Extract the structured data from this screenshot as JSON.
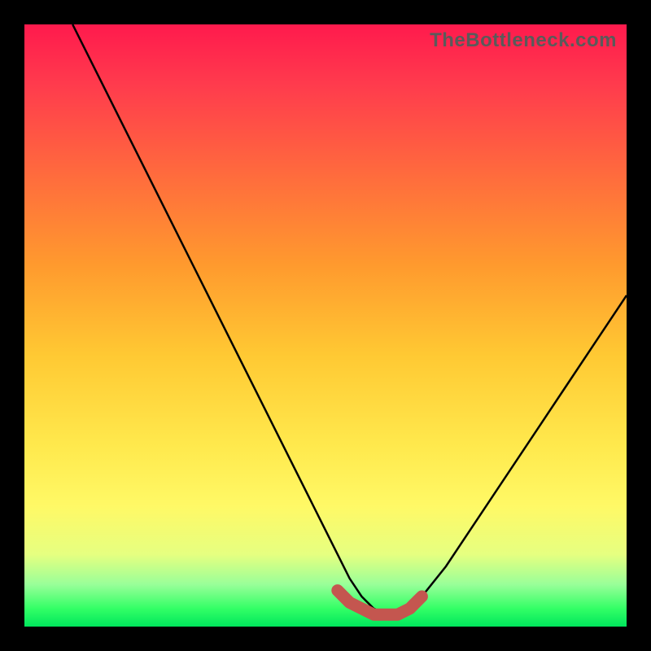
{
  "watermark": "TheBottleneck.com",
  "chart_data": {
    "type": "line",
    "title": "",
    "xlabel": "",
    "ylabel": "",
    "xlim": [
      0,
      100
    ],
    "ylim": [
      0,
      100
    ],
    "series": [
      {
        "name": "bottleneck-curve",
        "x": [
          8,
          12,
          16,
          20,
          24,
          28,
          32,
          36,
          40,
          44,
          48,
          52,
          54,
          56,
          58,
          60,
          62,
          64,
          66,
          70,
          74,
          78,
          82,
          86,
          90,
          94,
          98,
          100
        ],
        "y": [
          100,
          92,
          84,
          76,
          68,
          60,
          52,
          44,
          36,
          28,
          20,
          12,
          8,
          5,
          3,
          2,
          2,
          3,
          5,
          10,
          16,
          22,
          28,
          34,
          40,
          46,
          52,
          55
        ]
      },
      {
        "name": "optimal-region",
        "x": [
          52,
          54,
          56,
          58,
          60,
          62,
          64,
          66
        ],
        "y": [
          6,
          4,
          3,
          2,
          2,
          2,
          3,
          5
        ]
      }
    ],
    "annotations": []
  },
  "colors": {
    "curve": "#000000",
    "optimal": "#c4564f",
    "background_top": "#ff1a4d",
    "background_bottom": "#00e65c"
  }
}
